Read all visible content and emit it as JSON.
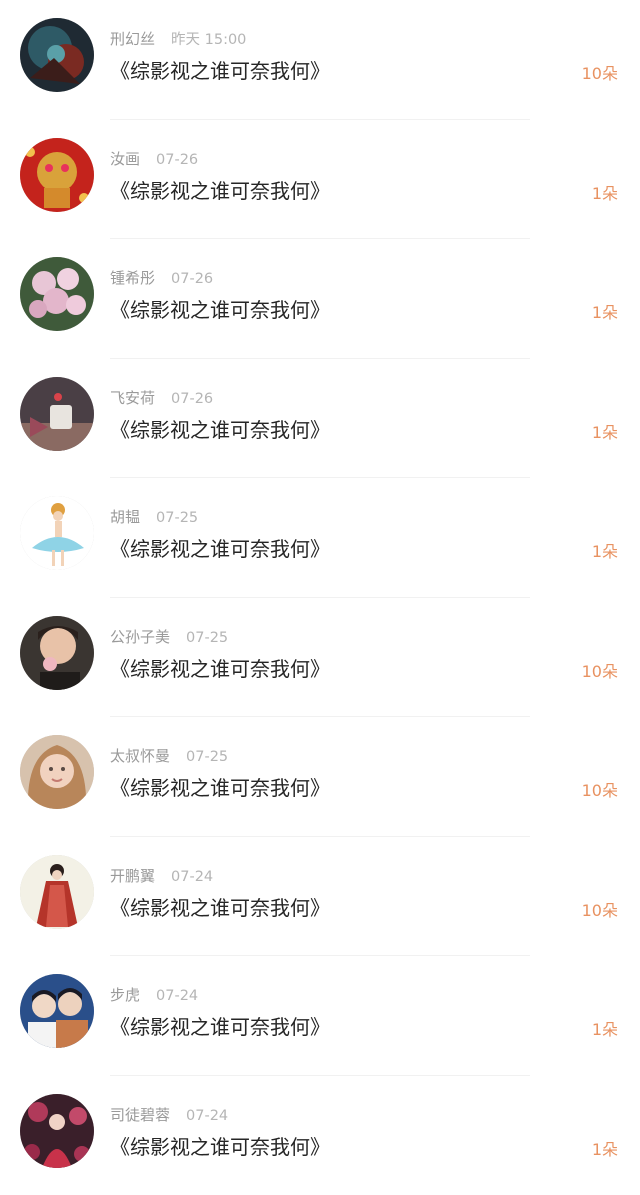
{
  "list": {
    "items": [
      {
        "name": "刑幻丝",
        "time": "昨天 15:00",
        "title": "《综影视之谁可奈我何》",
        "count": "10朵"
      },
      {
        "name": "汝画",
        "time": "07-26",
        "title": "《综影视之谁可奈我何》",
        "count": "1朵"
      },
      {
        "name": "锺希彤",
        "time": "07-26",
        "title": "《综影视之谁可奈我何》",
        "count": "1朵"
      },
      {
        "name": "飞安荷",
        "time": "07-26",
        "title": "《综影视之谁可奈我何》",
        "count": "1朵"
      },
      {
        "name": "胡韫",
        "time": "07-25",
        "title": "《综影视之谁可奈我何》",
        "count": "1朵"
      },
      {
        "name": "公孙子美",
        "time": "07-25",
        "title": "《综影视之谁可奈我何》",
        "count": "10朵"
      },
      {
        "name": "太叔怀曼",
        "time": "07-25",
        "title": "《综影视之谁可奈我何》",
        "count": "10朵"
      },
      {
        "name": "开鹏翼",
        "time": "07-24",
        "title": "《综影视之谁可奈我何》",
        "count": "10朵"
      },
      {
        "name": "步虎",
        "time": "07-24",
        "title": "《综影视之谁可奈我何》",
        "count": "1朵"
      },
      {
        "name": "司徒碧蓉",
        "time": "07-24",
        "title": "《综影视之谁可奈我何》",
        "count": "1朵"
      }
    ]
  },
  "colors": {
    "accent": "#e89261",
    "title_text": "#262626",
    "meta_text": "#9a9a9a",
    "divider": "#f1f1f1"
  }
}
